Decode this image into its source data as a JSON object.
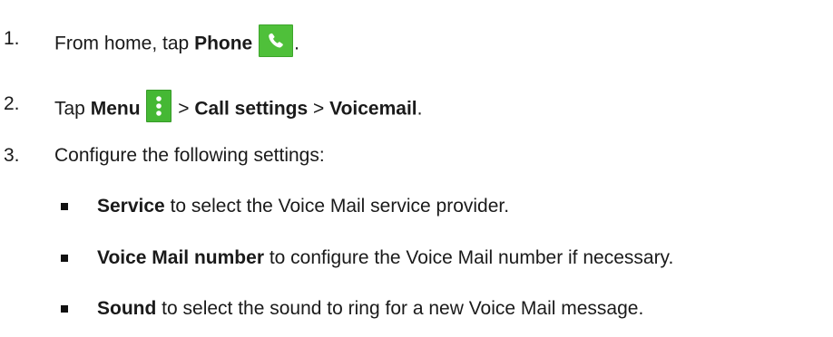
{
  "steps": [
    {
      "number": "1.",
      "parts": [
        "From home, tap ",
        "Phone",
        "."
      ],
      "icon": "phone-icon"
    },
    {
      "number": "2.",
      "parts": [
        "Tap ",
        "Menu",
        " > ",
        "Call settings",
        " > ",
        "Voicemail",
        "."
      ],
      "icon": "vertical-dots-menu-icon"
    },
    {
      "number": "3.",
      "text": "Configure the following settings:"
    }
  ],
  "settings": [
    {
      "name": "Service",
      "description": " to select the Voice Mail service provider."
    },
    {
      "name": "Voice Mail number",
      "description": " to configure the Voice Mail number if necessary."
    },
    {
      "name": "Sound",
      "description": " to select the sound to ring for a new Voice Mail message."
    }
  ],
  "colors": {
    "icon_green": "#4fc03a",
    "text": "#1a1a1a"
  }
}
